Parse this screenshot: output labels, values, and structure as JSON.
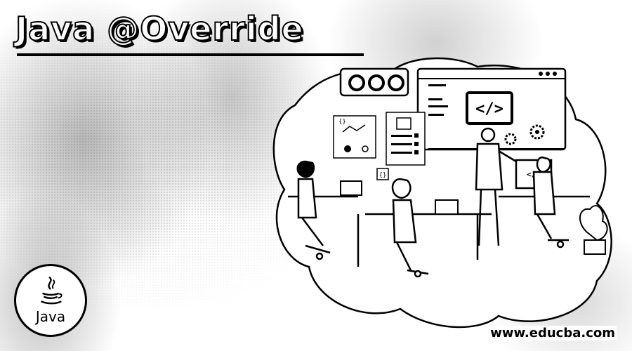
{
  "banner": {
    "title": "Java @Override",
    "logo_text": "Java",
    "url": "www.educba.com"
  },
  "illustration": {
    "code_badge_main": "</>",
    "code_badge_small": "</>",
    "brace_glyph": "{}"
  },
  "icons": [
    "java-cup-icon",
    "code-icon",
    "gear-icon",
    "person-icon",
    "laptop-icon"
  ]
}
